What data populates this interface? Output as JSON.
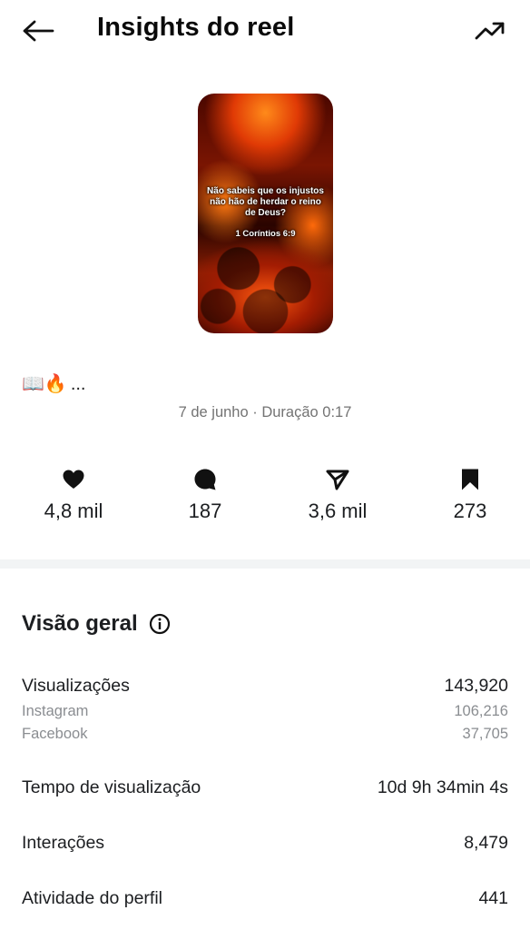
{
  "header": {
    "title": "Insights do reel",
    "back_icon": "arrow-left-icon",
    "trend_icon": "trending-up-icon"
  },
  "reel": {
    "overlay_text": "Não sabeis que os injustos não hão de herdar o reino de Deus?",
    "reference": "1 Coríntios 6:9",
    "caption_emojis": "📖🔥",
    "caption_ellipsis": "...",
    "meta": "7 de junho · Duração 0:17"
  },
  "stats": {
    "likes": "4,8 mil",
    "comments": "187",
    "shares": "3,6 mil",
    "saves": "273"
  },
  "overview": {
    "title": "Visão geral",
    "views_label": "Visualizações",
    "views_value": "143,920",
    "instagram_label": "Instagram",
    "instagram_value": "106,216",
    "facebook_label": "Facebook",
    "facebook_value": "37,705",
    "watch_time_label": "Tempo de visualização",
    "watch_time_value": "10d 9h 34min 4s",
    "interactions_label": "Interações",
    "interactions_value": "8,479",
    "profile_activity_label": "Atividade do perfil",
    "profile_activity_value": "441"
  },
  "colors": {
    "text": "#1c1e21",
    "muted": "#737373",
    "subtle": "#8a8d91",
    "divider": "#f2f4f5"
  }
}
